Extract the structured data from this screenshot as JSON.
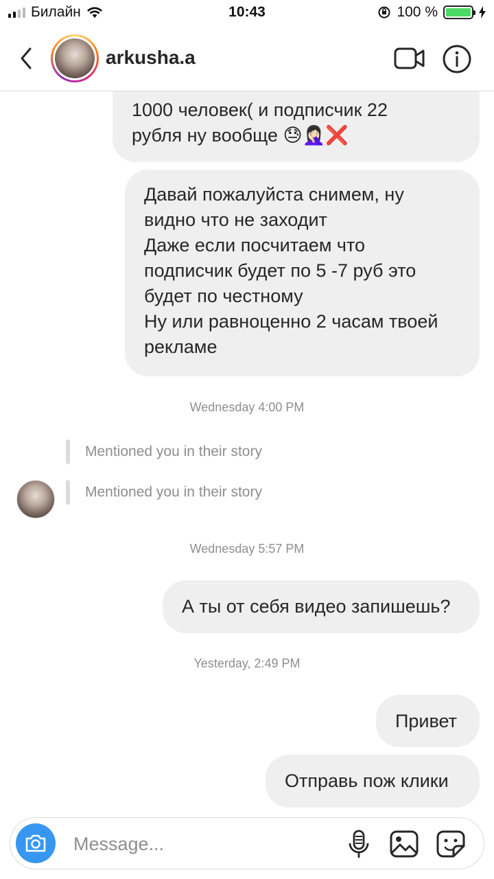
{
  "status_bar": {
    "carrier": "Билайн",
    "time": "10:43",
    "battery": "100 %"
  },
  "header": {
    "username": "arkusha.a"
  },
  "messages": {
    "m1_lines": [
      "1000 человек( и подписчик 22",
      "рубля ну вообще 😓🤦🏻‍♀️❌"
    ],
    "m2_lines": [
      "Давай пожалуйста снимем, ну",
      "видно что не заходит",
      "Даже если посчитаем что",
      "подписчик будет по 5 -7 руб это",
      "будет по честному",
      "Ну или равноценно 2 часам твоей",
      "рекламе"
    ],
    "ts1": "Wednesday 4:00 PM",
    "mention1": "Mentioned you in their story",
    "mention2": "Mentioned you in their story",
    "ts2": "Wednesday 5:57 PM",
    "m3": "А ты от себя видео запишешь?",
    "ts3": "Yesterday, 2:49 PM",
    "m4": "Привет",
    "m5": "Отправь пож клики"
  },
  "composer": {
    "placeholder": "Message..."
  },
  "icons": {
    "camera": "camera-icon",
    "mic": "microphone-icon",
    "gallery": "gallery-icon",
    "sticker": "sticker-icon",
    "video": "video-call-icon",
    "info": "info-icon",
    "back": "back-chevron-icon"
  },
  "colors": {
    "accent": "#3797f0",
    "bubble": "#efefef",
    "muted": "#8e8e8e"
  }
}
